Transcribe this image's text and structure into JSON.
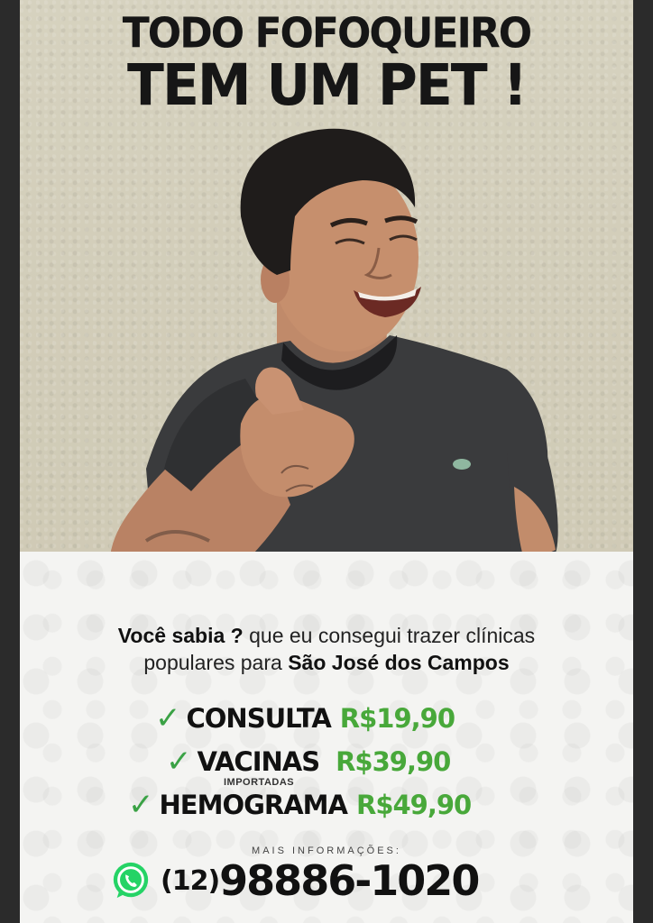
{
  "headline": {
    "line1": "TODO FOFOQUEIRO",
    "line2": "TEM UM PET !"
  },
  "intro": {
    "bold1": "Você sabia ?",
    "text1": " que eu consegui trazer clínicas",
    "text2": "populares para ",
    "bold2": "São José dos Campos"
  },
  "prices": [
    {
      "name": "CONSULTA",
      "value": "R$19,90",
      "note": ""
    },
    {
      "name": "VACINAS",
      "value": "R$39,90",
      "note": "IMPORTADAS"
    },
    {
      "name": "HEMOGRAMA",
      "value": "R$49,90",
      "note": ""
    }
  ],
  "contact": {
    "label": "MAIS INFORMAÇÕES:",
    "area_code": "(12)",
    "number": "98886-1020",
    "icon": "whatsapp-icon"
  },
  "colors": {
    "green": "#48a83a",
    "check": "#3aa245",
    "whatsapp": "#25d366"
  }
}
